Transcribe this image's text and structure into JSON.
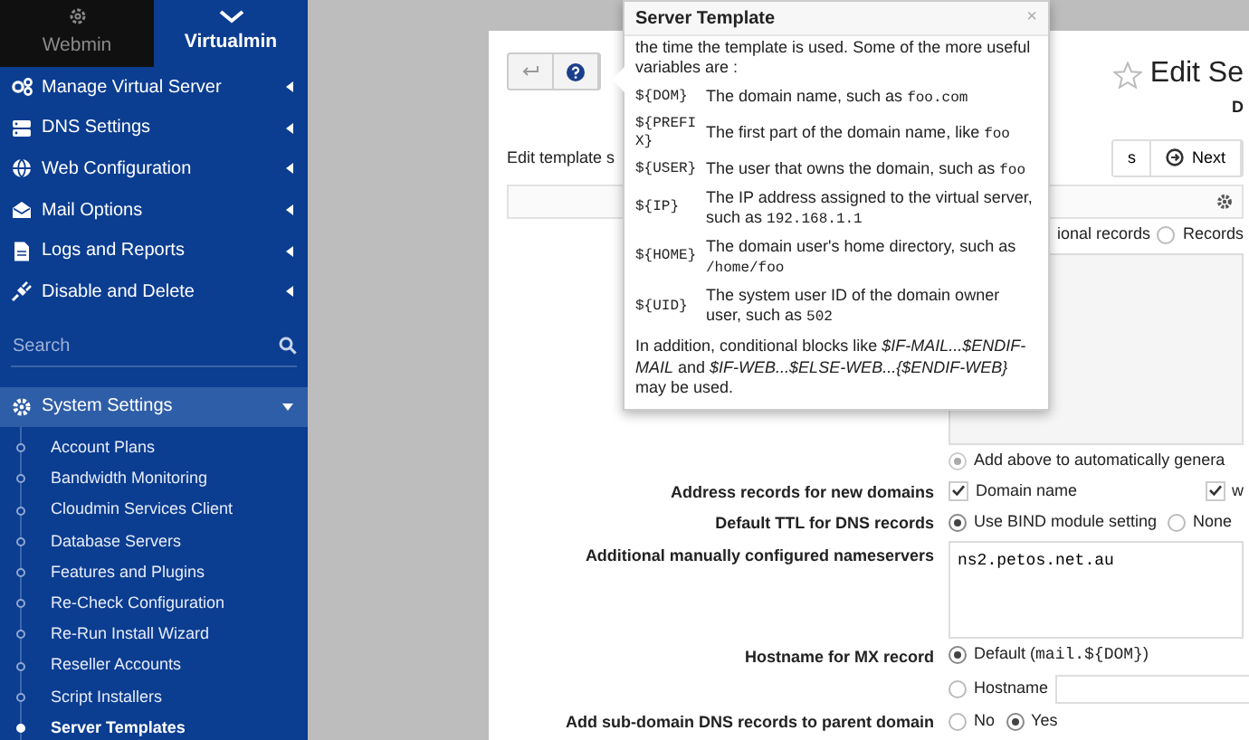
{
  "sidebar": {
    "tabs": [
      {
        "label": "Webmin",
        "selected": false
      },
      {
        "label": "Virtualmin",
        "selected": true
      }
    ],
    "menu": [
      {
        "label": "Manage Virtual Server"
      },
      {
        "label": "DNS Settings"
      },
      {
        "label": "Web Configuration"
      },
      {
        "label": "Mail Options"
      },
      {
        "label": "Logs and Reports"
      },
      {
        "label": "Disable and Delete"
      }
    ],
    "search": {
      "placeholder": "Search"
    },
    "section": {
      "label": "System Settings",
      "expanded": true,
      "items": [
        {
          "label": "Account Plans",
          "selected": false
        },
        {
          "label": "Bandwidth Monitoring",
          "selected": false
        },
        {
          "label": "Cloudmin Services Client",
          "selected": false
        },
        {
          "label": "Database Servers",
          "selected": false
        },
        {
          "label": "Features and Plugins",
          "selected": false
        },
        {
          "label": "Re-Check Configuration",
          "selected": false
        },
        {
          "label": "Re-Run Install Wizard",
          "selected": false
        },
        {
          "label": "Reseller Accounts",
          "selected": false
        },
        {
          "label": "Script Installers",
          "selected": false
        },
        {
          "label": "Server Templates",
          "selected": true
        }
      ]
    }
  },
  "page": {
    "title": "Edit Se",
    "subtitle": "D",
    "intro": "Edit template s",
    "buttons": [
      {
        "kind": "plain",
        "label": "s"
      },
      {
        "kind": "next",
        "label": "Next"
      }
    ],
    "top_row": {
      "text": "ional records",
      "option": {
        "label": "Records",
        "selected": false
      }
    },
    "form": [
      {
        "kind": "textarea"
      },
      {
        "kind": "note",
        "options": [
          {
            "label": "Add above to automatically genera",
            "selected": true
          }
        ]
      },
      {
        "kind": "checks",
        "label": "Address records for new domains",
        "options": [
          {
            "label": "Domain name",
            "checked": true
          },
          {
            "label": "w",
            "checked": true
          }
        ]
      },
      {
        "kind": "radios",
        "label": "Default TTL for DNS records",
        "options": [
          {
            "label": "Use BIND module setting",
            "selected": true
          },
          {
            "label": "None",
            "selected": false
          }
        ]
      },
      {
        "kind": "textarea",
        "label": "Additional manually configured nameservers",
        "value": "ns2.petos.net.au"
      },
      {
        "kind": "stacked",
        "label": "Hostname for MX record",
        "options": [
          {
            "label": "Default (",
            "code": "mail.${DOM}",
            "suffix": ")",
            "selected": true
          },
          {
            "label": "Hostname",
            "selected": false,
            "field": true
          }
        ]
      },
      {
        "kind": "radios",
        "label": "Add sub-domain DNS records to parent domain",
        "options": [
          {
            "label": "No",
            "selected": false
          },
          {
            "label": "Yes",
            "selected": true
          }
        ]
      }
    ]
  },
  "popover": {
    "title": "Server Template",
    "close": "×",
    "intro": "the time the template is used. Some of the more useful variables are :",
    "variables": [
      {
        "name": "${DOM}",
        "text": "The domain name, such as ",
        "code": "foo.com"
      },
      {
        "name": "${PREFIX}",
        "text": "The first part of the domain name, like ",
        "code": "foo"
      },
      {
        "name": "${USER}",
        "text": "The user that owns the domain, such as ",
        "code": "foo"
      },
      {
        "name": "${IP}",
        "text": "The IP address assigned to the virtual server, such as ",
        "code": "192.168.1.1"
      },
      {
        "name": "${HOME}",
        "text": "The domain user's home directory, such as ",
        "code": "/home/foo"
      },
      {
        "name": "${UID}",
        "text": "The system user ID of the domain owner user, such as ",
        "code": "502"
      }
    ],
    "footer": "In addition, conditional blocks like *$IF-MAIL...$ENDIF-MAIL* and *$IF-WEB...$ELSE-WEB...{$ENDIF-WEB}* may be used."
  }
}
